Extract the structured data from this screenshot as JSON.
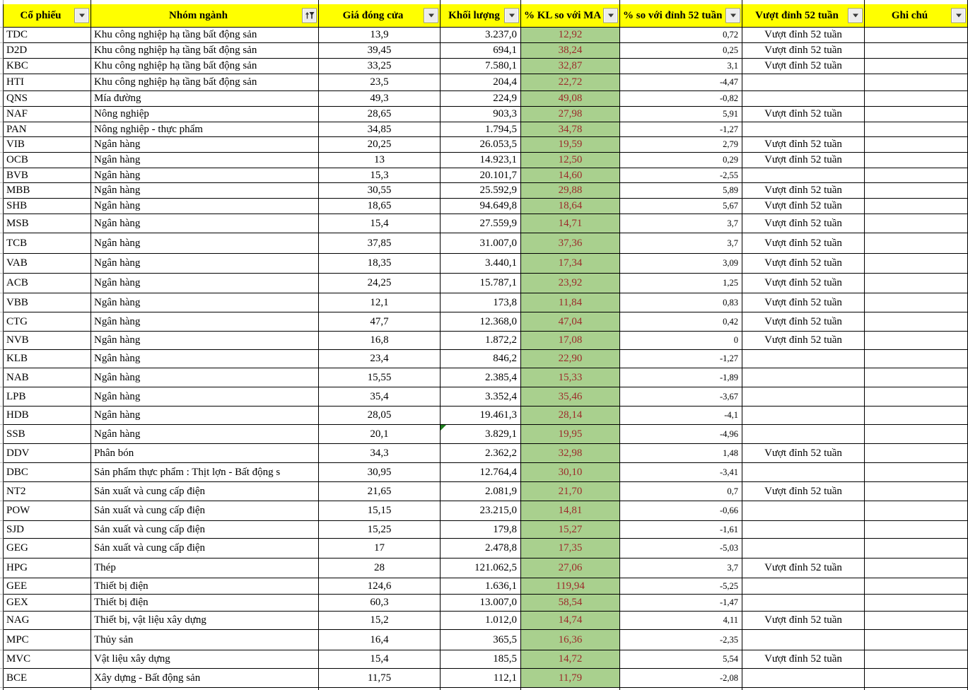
{
  "sheet": {
    "columns": [
      {
        "key": "ticker",
        "label": "Cổ phiếu"
      },
      {
        "key": "industry",
        "label": "Nhóm ngành"
      },
      {
        "key": "close",
        "label": "Giá đóng cửa"
      },
      {
        "key": "volume",
        "label": "Khối lượng"
      },
      {
        "key": "vol_ma_pct",
        "label": "% KL so với MA"
      },
      {
        "key": "peak_pct",
        "label": "% so với đỉnh 52 tuần"
      },
      {
        "key": "peak_label",
        "label": "Vượt đỉnh 52 tuần"
      },
      {
        "key": "note",
        "label": "Ghi chú"
      }
    ],
    "rows": [
      {
        "ticker": "TDC",
        "industry": "Khu công nghiệp hạ tầng bất động sản",
        "close": "13,9",
        "volume": "3.237,0",
        "vol_ma_pct": "12,92",
        "peak_pct": "0,72",
        "peak_label": "Vượt đỉnh 52 tuần",
        "note": ""
      },
      {
        "ticker": "D2D",
        "industry": "Khu công nghiệp hạ tầng bất động sản",
        "close": "39,45",
        "volume": "694,1",
        "vol_ma_pct": "38,24",
        "peak_pct": "0,25",
        "peak_label": "Vượt đỉnh 52 tuần",
        "note": ""
      },
      {
        "ticker": "KBC",
        "industry": "Khu công nghiệp hạ tầng bất động sản",
        "close": "33,25",
        "volume": "7.580,1",
        "vol_ma_pct": "32,87",
        "peak_pct": "3,1",
        "peak_label": "Vượt đỉnh 52 tuần",
        "note": ""
      },
      {
        "ticker": "HTI",
        "industry": "Khu công nghiệp hạ tầng bất động sản",
        "close": "23,5",
        "volume": "204,4",
        "vol_ma_pct": "22,72",
        "peak_pct": "-4,47",
        "peak_label": "",
        "note": ""
      },
      {
        "ticker": "QNS",
        "industry": "Mía đường",
        "close": "49,3",
        "volume": "224,9",
        "vol_ma_pct": "49,08",
        "peak_pct": "-0,82",
        "peak_label": "",
        "note": ""
      },
      {
        "ticker": "NAF",
        "industry": "Nông nghiệp",
        "close": "28,65",
        "volume": "903,3",
        "vol_ma_pct": "27,98",
        "peak_pct": "5,91",
        "peak_label": "Vượt đỉnh 52 tuần",
        "note": ""
      },
      {
        "ticker": "PAN",
        "industry": "Nông nghiệp - thực phẩm",
        "close": "34,85",
        "volume": "1.794,5",
        "vol_ma_pct": "34,78",
        "peak_pct": "-1,27",
        "peak_label": "",
        "note": ""
      },
      {
        "ticker": "VIB",
        "industry": "Ngân hàng",
        "close": "20,25",
        "volume": "26.053,5",
        "vol_ma_pct": "19,59",
        "peak_pct": "2,79",
        "peak_label": "Vượt đỉnh 52 tuần",
        "note": ""
      },
      {
        "ticker": "OCB",
        "industry": "Ngân hàng",
        "close": "13",
        "volume": "14.923,1",
        "vol_ma_pct": "12,50",
        "peak_pct": "0,29",
        "peak_label": "Vượt đỉnh 52 tuần",
        "note": ""
      },
      {
        "ticker": "BVB",
        "industry": "Ngân hàng",
        "close": "15,3",
        "volume": "20.101,7",
        "vol_ma_pct": "14,60",
        "peak_pct": "-2,55",
        "peak_label": "",
        "note": ""
      },
      {
        "ticker": "MBB",
        "industry": "Ngân hàng",
        "close": "30,55",
        "volume": "25.592,9",
        "vol_ma_pct": "29,88",
        "peak_pct": "5,89",
        "peak_label": "Vượt đỉnh 52 tuần",
        "note": ""
      },
      {
        "ticker": "SHB",
        "industry": "Ngân hàng",
        "close": "18,65",
        "volume": "94.649,8",
        "vol_ma_pct": "18,64",
        "peak_pct": "5,67",
        "peak_label": "Vượt đỉnh 52 tuần",
        "note": ""
      },
      {
        "ticker": "MSB",
        "industry": "Ngân hàng",
        "close": "15,4",
        "volume": "27.559,9",
        "vol_ma_pct": "14,71",
        "peak_pct": "3,7",
        "peak_label": "Vượt đỉnh 52 tuần",
        "note": ""
      },
      {
        "ticker": "TCB",
        "industry": "Ngân hàng",
        "close": "37,85",
        "volume": "31.007,0",
        "vol_ma_pct": "37,36",
        "peak_pct": "3,7",
        "peak_label": "Vượt đỉnh 52 tuần",
        "note": ""
      },
      {
        "ticker": "VAB",
        "industry": "Ngân hàng",
        "close": "18,35",
        "volume": "3.440,1",
        "vol_ma_pct": "17,34",
        "peak_pct": "3,09",
        "peak_label": "Vượt đỉnh 52 tuần",
        "note": ""
      },
      {
        "ticker": "ACB",
        "industry": "Ngân hàng",
        "close": "24,25",
        "volume": "15.787,1",
        "vol_ma_pct": "23,92",
        "peak_pct": "1,25",
        "peak_label": "Vượt đỉnh 52 tuần",
        "note": ""
      },
      {
        "ticker": "VBB",
        "industry": "Ngân hàng",
        "close": "12,1",
        "volume": "173,8",
        "vol_ma_pct": "11,84",
        "peak_pct": "0,83",
        "peak_label": "Vượt đỉnh 52 tuần",
        "note": ""
      },
      {
        "ticker": "CTG",
        "industry": "Ngân hàng",
        "close": "47,7",
        "volume": "12.368,0",
        "vol_ma_pct": "47,04",
        "peak_pct": "0,42",
        "peak_label": "Vượt đỉnh 52 tuần",
        "note": ""
      },
      {
        "ticker": "NVB",
        "industry": "Ngân hàng",
        "close": "16,8",
        "volume": "1.872,2",
        "vol_ma_pct": "17,08",
        "peak_pct": "0",
        "peak_label": "Vượt đỉnh 52 tuần",
        "note": ""
      },
      {
        "ticker": "KLB",
        "industry": "Ngân hàng",
        "close": "23,4",
        "volume": "846,2",
        "vol_ma_pct": "22,90",
        "peak_pct": "-1,27",
        "peak_label": "",
        "note": ""
      },
      {
        "ticker": "NAB",
        "industry": "Ngân hàng",
        "close": "15,55",
        "volume": "2.385,4",
        "vol_ma_pct": "15,33",
        "peak_pct": "-1,89",
        "peak_label": "",
        "note": ""
      },
      {
        "ticker": "LPB",
        "industry": "Ngân hàng",
        "close": "35,4",
        "volume": "3.352,4",
        "vol_ma_pct": "35,46",
        "peak_pct": "-3,67",
        "peak_label": "",
        "note": ""
      },
      {
        "ticker": "HDB",
        "industry": "Ngân hàng",
        "close": "28,05",
        "volume": "19.461,3",
        "vol_ma_pct": "28,14",
        "peak_pct": "-4,1",
        "peak_label": "",
        "note": ""
      },
      {
        "ticker": "SSB",
        "industry": "Ngân hàng",
        "close": "20,1",
        "volume": "3.829,1",
        "vol_ma_pct": "19,95",
        "peak_pct": "-4,96",
        "peak_label": "",
        "note": "",
        "volume_comment": true
      },
      {
        "ticker": "DDV",
        "industry": "Phân bón",
        "close": "34,3",
        "volume": "2.362,2",
        "vol_ma_pct": "32,98",
        "peak_pct": "1,48",
        "peak_label": "Vượt đỉnh 52 tuần",
        "note": ""
      },
      {
        "ticker": "DBC",
        "industry": "Sản phẩm thực phẩm : Thịt lợn - Bất động s",
        "close": "30,95",
        "volume": "12.764,4",
        "vol_ma_pct": "30,10",
        "peak_pct": "-3,41",
        "peak_label": "",
        "note": ""
      },
      {
        "ticker": "NT2",
        "industry": "Sản xuất và cung cấp điện",
        "close": "21,65",
        "volume": "2.081,9",
        "vol_ma_pct": "21,70",
        "peak_pct": "0,7",
        "peak_label": "Vượt đỉnh 52 tuần",
        "note": ""
      },
      {
        "ticker": "POW",
        "industry": "Sản xuất và cung cấp điện",
        "close": "15,15",
        "volume": "23.215,0",
        "vol_ma_pct": "14,81",
        "peak_pct": "-0,66",
        "peak_label": "",
        "note": ""
      },
      {
        "ticker": "SJD",
        "industry": "Sản xuất và cung cấp điện",
        "close": "15,25",
        "volume": "179,8",
        "vol_ma_pct": "15,27",
        "peak_pct": "-1,61",
        "peak_label": "",
        "note": ""
      },
      {
        "ticker": "GEG",
        "industry": "Sản xuất và cung cấp điện",
        "close": "17",
        "volume": "2.478,8",
        "vol_ma_pct": "17,35",
        "peak_pct": "-5,03",
        "peak_label": "",
        "note": ""
      },
      {
        "ticker": "HPG",
        "industry": "Thép",
        "close": "28",
        "volume": "121.062,5",
        "vol_ma_pct": "27,06",
        "peak_pct": "3,7",
        "peak_label": "Vượt đỉnh 52 tuần",
        "note": ""
      },
      {
        "ticker": "GEE",
        "industry": "Thiết bị điện",
        "close": "124,6",
        "volume": "1.636,1",
        "vol_ma_pct": "119,94",
        "peak_pct": "-5,25",
        "peak_label": "",
        "note": ""
      },
      {
        "ticker": "GEX",
        "industry": "Thiết bị điện",
        "close": "60,3",
        "volume": "13.007,0",
        "vol_ma_pct": "58,54",
        "peak_pct": "-1,47",
        "peak_label": "",
        "note": ""
      },
      {
        "ticker": "NAG",
        "industry": "Thiết bị, vật liệu xây dựng",
        "close": "15,2",
        "volume": "1.012,0",
        "vol_ma_pct": "14,74",
        "peak_pct": "4,11",
        "peak_label": "Vượt đỉnh 52 tuần",
        "note": ""
      },
      {
        "ticker": "MPC",
        "industry": "Thủy sản",
        "close": "16,4",
        "volume": "365,5",
        "vol_ma_pct": "16,36",
        "peak_pct": "-2,35",
        "peak_label": "",
        "note": ""
      },
      {
        "ticker": "MVC",
        "industry": "Vật liệu xây dựng",
        "close": "15,4",
        "volume": "185,5",
        "vol_ma_pct": "14,72",
        "peak_pct": "5,54",
        "peak_label": "Vượt đỉnh 52 tuần",
        "note": ""
      },
      {
        "ticker": "BCE",
        "industry": "Xây dựng - Bất động sản",
        "close": "11,75",
        "volume": "112,1",
        "vol_ma_pct": "11,79",
        "peak_pct": "-2,08",
        "peak_label": "",
        "note": ""
      }
    ],
    "colors": {
      "header_bg": "#FFFF00",
      "highlight_fill": "#A9D08E",
      "highlight_text": "#9C2A2A",
      "comment_marker": "#1E7D1E",
      "grid": "#000000"
    }
  }
}
